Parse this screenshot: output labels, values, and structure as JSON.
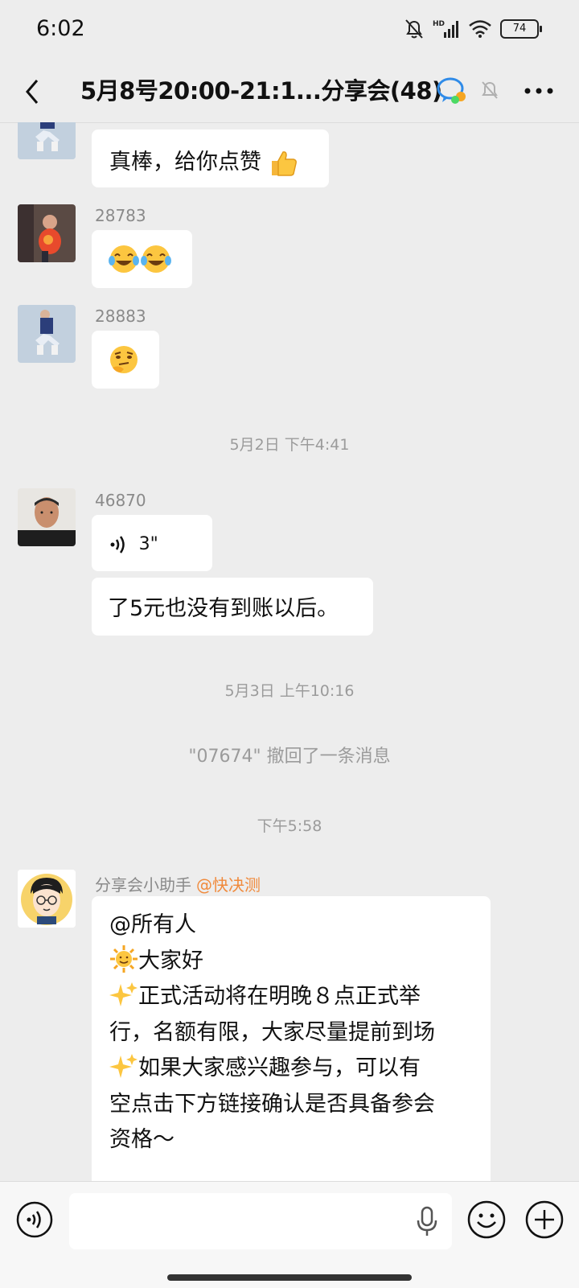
{
  "status_bar": {
    "time": "6:02",
    "battery": "74"
  },
  "header": {
    "title": "5月8号20:00-21:1...分享会(48)"
  },
  "messages": {
    "m1": {
      "text": "真棒，给你点赞"
    },
    "m2": {
      "sender": "28783"
    },
    "m3": {
      "sender": "28883"
    },
    "t1": "5月2日 下午4:41",
    "m4": {
      "sender": "46870",
      "voice_duration": "3\"",
      "text": "了5元也没有到账以后。"
    },
    "t2": "5月3日 上午10:16",
    "recall": "\"07674\" 撤回了一条消息",
    "t3": "下午5:58",
    "m5": {
      "sender": "分享会小助手",
      "tag": "@快决测",
      "line1": "@所有人",
      "line2": "大家好",
      "line3a": "正式活动将在明晚８点正式举",
      "line3b": "行，名额有限，大家尽量提前到场",
      "line4a": "如果大家感兴趣参与，可以有",
      "line4b": "空点击下方链接确认是否具备参会",
      "line4c": "资格～"
    }
  },
  "icons": {
    "back": "back-arrow-icon",
    "more": "more-icon",
    "voice": "voice-icon",
    "mic": "microphone-icon",
    "emoji": "emoji-icon",
    "plus": "plus-icon"
  }
}
